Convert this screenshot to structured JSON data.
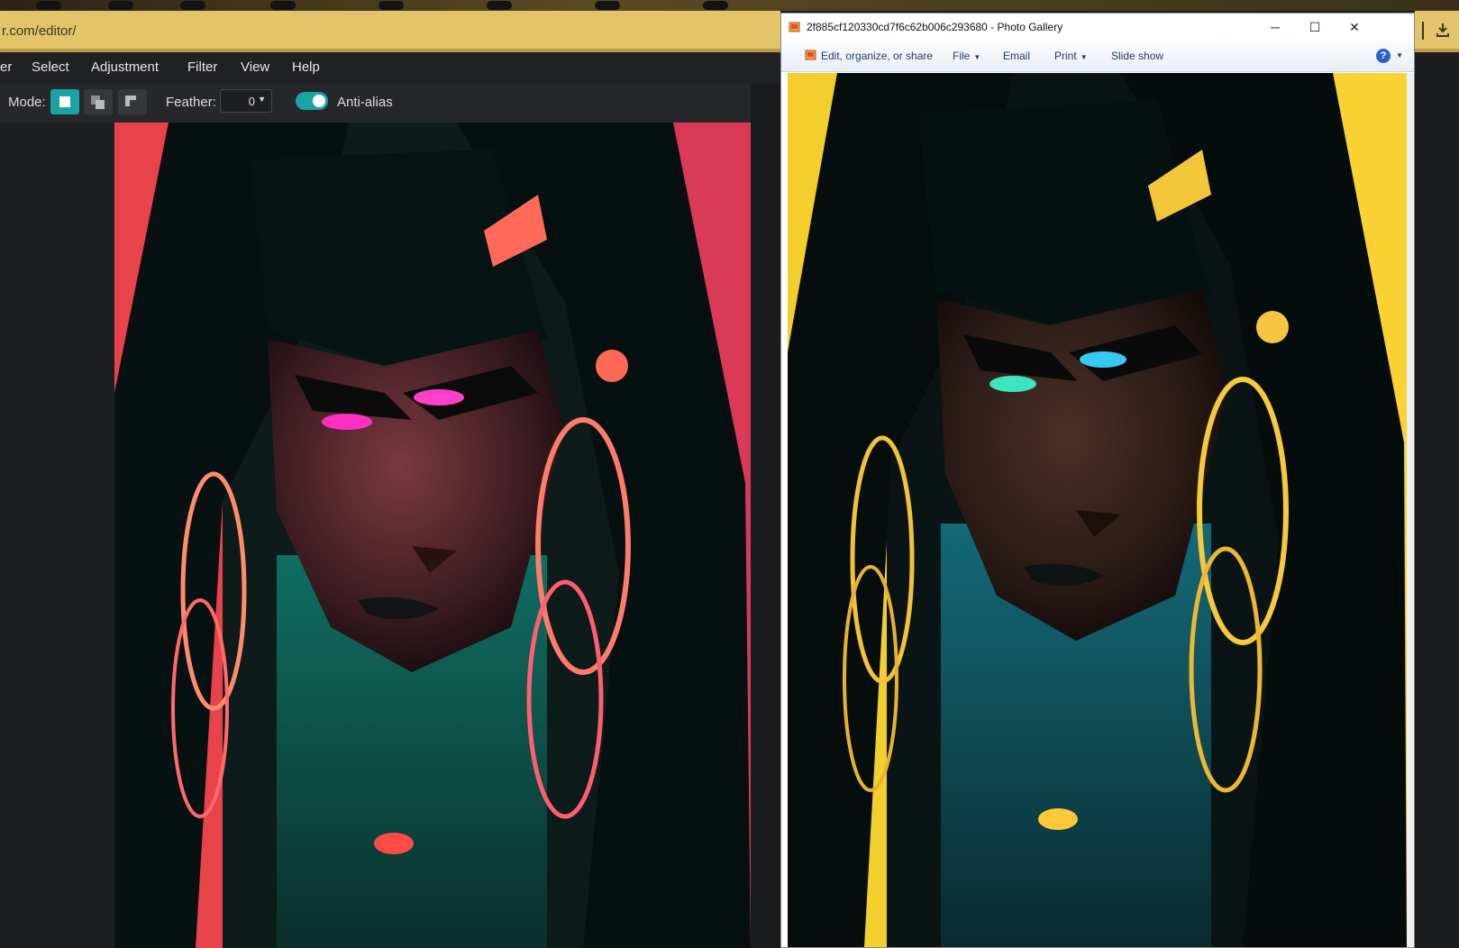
{
  "browser": {
    "url_fragment": "r.com/editor/"
  },
  "editor": {
    "menu": [
      {
        "id": "layer",
        "label": "er"
      },
      {
        "id": "select",
        "label": "Select"
      },
      {
        "id": "adjustment",
        "label": "Adjustment"
      },
      {
        "id": "filter",
        "label": "Filter"
      },
      {
        "id": "view",
        "label": "View"
      },
      {
        "id": "help",
        "label": "Help"
      }
    ],
    "toolbar": {
      "mode_label": "Mode:",
      "mode_selected": "new-selection",
      "feather_label": "Feather:",
      "feather_value": "0",
      "antialias_label": "Anti-alias",
      "antialias_on": true
    },
    "colors": {
      "accent": "#1aa3a3",
      "menubar": "#202124",
      "toolbar": "#26272a"
    }
  },
  "photo_gallery": {
    "title": "2f885cf120330cd7f6c62b006c293680 - Photo Gallery",
    "commands": [
      {
        "id": "edit",
        "label": "Edit, organize, or share",
        "dropdown": false
      },
      {
        "id": "file",
        "label": "File",
        "dropdown": true
      },
      {
        "id": "email",
        "label": "Email",
        "dropdown": false
      },
      {
        "id": "print",
        "label": "Print",
        "dropdown": true
      },
      {
        "id": "slideshow",
        "label": "Slide show",
        "dropdown": false
      }
    ],
    "help_glyph": "?",
    "window_controls": {
      "minimize": "─",
      "maximize": "☐",
      "close": "✕"
    }
  }
}
